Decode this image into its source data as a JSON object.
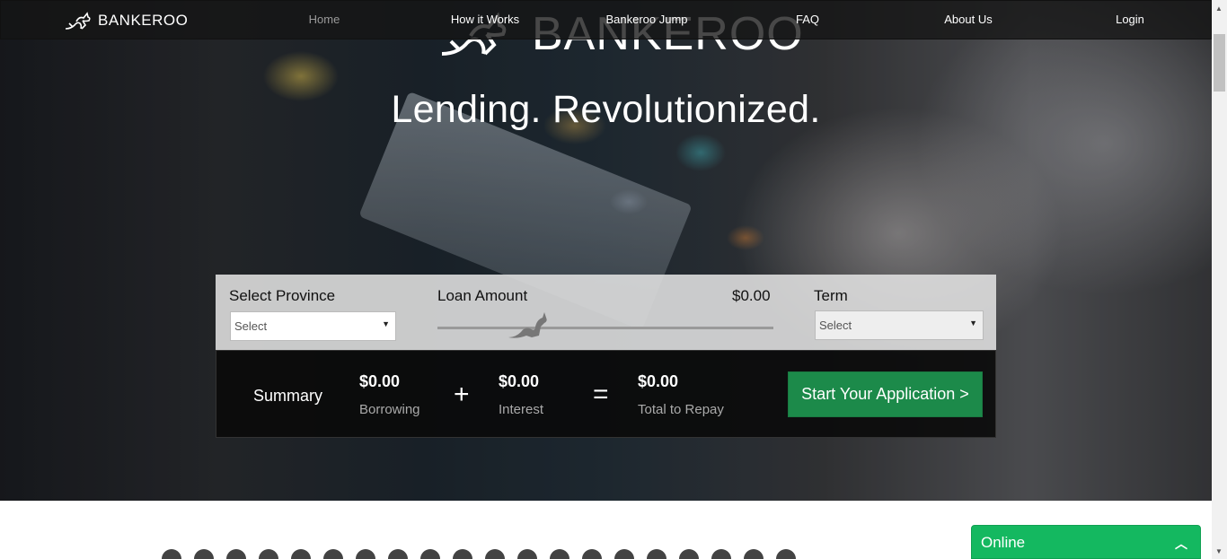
{
  "nav": {
    "brand": "BANKEROO",
    "links": [
      "Home",
      "How it Works",
      "Bankeroo Jump",
      "FAQ",
      "About Us",
      "Login"
    ]
  },
  "hero": {
    "logo_text": "BANKEROO",
    "tagline": "Lending. Revolutionized."
  },
  "calculator": {
    "province_label": "Select Province",
    "province_value": "Select",
    "loan_label": "Loan Amount",
    "loan_value": "$0.00",
    "term_label": "Term",
    "term_value": "Select",
    "slider_level": 0.25
  },
  "summary": {
    "label": "Summary",
    "borrowing_value": "$0.00",
    "borrowing_label": "Borrowing",
    "plus": "+",
    "interest_value": "$0.00",
    "interest_label": "Interest",
    "equals": "=",
    "total_value": "$0.00",
    "total_label": "Total to Repay",
    "cta": "Start Your Application >"
  },
  "chat": {
    "status": "Online",
    "toggle_icon": "chevron-up-icon"
  },
  "colors": {
    "cta_green": "#1c8a4a",
    "chat_green": "#14b860",
    "nav_bg": "#141414"
  }
}
